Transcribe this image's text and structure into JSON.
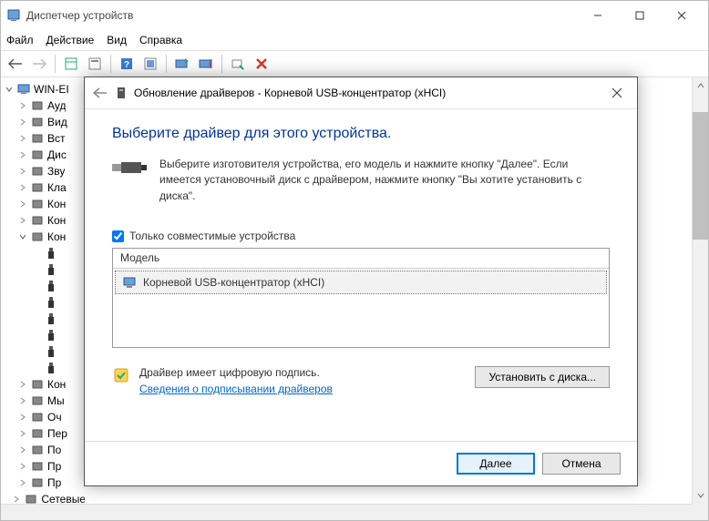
{
  "window": {
    "title": "Диспетчер устройств"
  },
  "menu": {
    "file": "Файл",
    "action": "Действие",
    "view": "Вид",
    "help": "Справка"
  },
  "tree": {
    "root": "WIN-EI",
    "items": [
      "Ауд",
      "Вид",
      "Вст",
      "Дис",
      "Зву",
      "Кла",
      "Кон",
      "Кон",
      "Кон"
    ],
    "usb_children": [
      "",
      "",
      "",
      "",
      "",
      "",
      "",
      ""
    ],
    "more": [
      "Кон",
      "Мы",
      "Оч",
      "Пер",
      "По",
      "Пр",
      "Пр"
    ],
    "last": "Сетевые адаптеры"
  },
  "dialog": {
    "title": "Обновление драйверов - Корневой USB-концентратор (xHCI)",
    "heading": "Выберите драйвер для этого устройства.",
    "instruction": "Выберите изготовителя устройства, его модель и нажмите кнопку \"Далее\". Если имеется установочный диск с  драйвером, нажмите кнопку \"Вы хотите установить с диска\".",
    "compat_label": "Только совместимые устройства",
    "list_header": "Модель",
    "list_item": "Корневой USB-концентратор (xHCI)",
    "signed": "Драйвер имеет цифровую подпись.",
    "sign_link": "Сведения о подписывании драйверов",
    "install_disk": "Установить с диска...",
    "next": "Далее",
    "cancel": "Отмена"
  }
}
